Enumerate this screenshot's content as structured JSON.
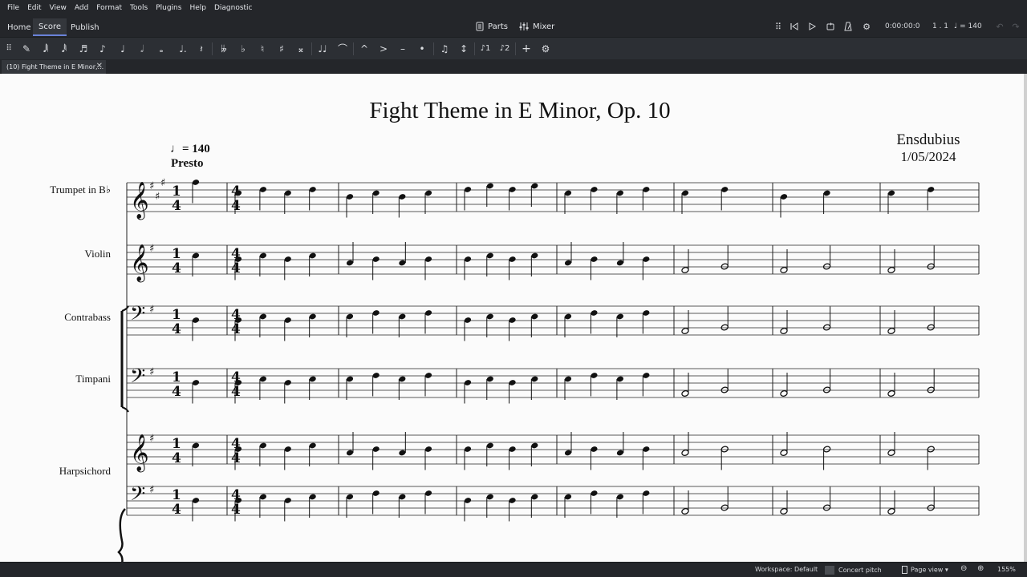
{
  "menubar": {
    "items": [
      "File",
      "Edit",
      "View",
      "Add",
      "Format",
      "Tools",
      "Plugins",
      "Help",
      "Diagnostic"
    ]
  },
  "modes": {
    "tabs": [
      "Home",
      "Score",
      "Publish"
    ],
    "active": "Score"
  },
  "center_buttons": {
    "parts": "Parts",
    "mixer": "Mixer"
  },
  "playback": {
    "time": "0:00:00:0",
    "position": "1 . 1",
    "tempo": "= 140"
  },
  "note_toolbar": {
    "icons": [
      "pen-icon",
      "64th-note-icon",
      "32nd-note-icon",
      "16th-note-icon",
      "eighth-note-icon",
      "quarter-note-icon",
      "half-note-icon",
      "whole-note-icon",
      "augmentation-dot-icon",
      "rest-icon",
      "double-flat-icon",
      "flat-icon",
      "natural-icon",
      "sharp-icon",
      "double-sharp-icon",
      "tie-icon",
      "slur-icon",
      "marcato-icon",
      "accent-icon",
      "tenuto-icon",
      "staccato-icon",
      "tuplet-icon",
      "flip-direction-icon",
      "voice-1-icon",
      "voice-2-icon",
      "add-icon",
      "settings-gear-icon"
    ]
  },
  "document_tab": {
    "title": "(10) Fight Theme in E Minor,..."
  },
  "score": {
    "title": "Fight Theme in E Minor, Op. 10",
    "composer": "Ensdubius",
    "date": "1/05/2024",
    "tempo": {
      "beat_unit": "quarter",
      "bpm": "= 140",
      "text": "Presto"
    },
    "instruments": [
      {
        "name": "Trumpet in B♭"
      },
      {
        "name": "Violin"
      },
      {
        "name": "Contrabass"
      },
      {
        "name": "Timpani"
      },
      {
        "name": "Harpsichord"
      }
    ],
    "measures_on_system": 8,
    "first_measure_time_signature": "1/4",
    "later_time_signature": "4/4"
  },
  "statusbar": {
    "workspace": "Workspace: Default",
    "concert_pitch": "Concert pitch",
    "view_mode": "Page view",
    "zoom": "155%"
  }
}
